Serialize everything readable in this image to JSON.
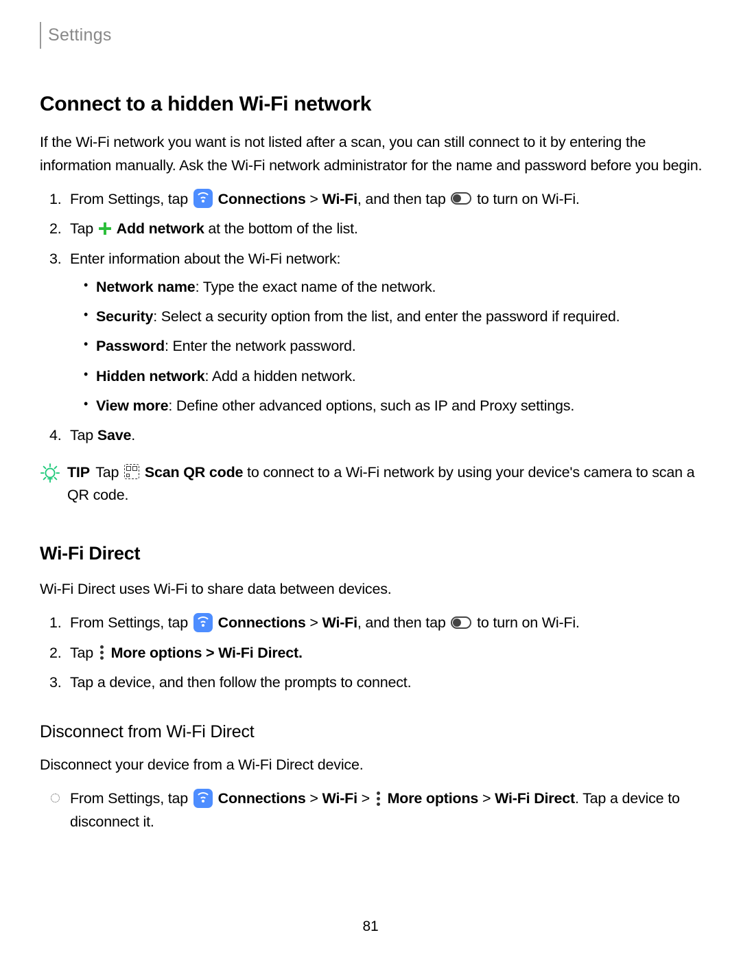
{
  "breadcrumb": "Settings",
  "pageNum": "81",
  "s1": {
    "title": "Connect to a hidden Wi-Fi network",
    "intro": "If the Wi-Fi network you want is not listed after a scan, you can still connect to it by entering the information manually. Ask the Wi-Fi network administrator for the name and password before you begin.",
    "step1_a": "From Settings, tap",
    "step1_b": "Connections",
    "step1_c": ">",
    "step1_d": "Wi-Fi",
    "step1_e": ", and then tap",
    "step1_f": "to turn on Wi-Fi.",
    "step2_a": "Tap",
    "step2_b": "Add network",
    "step2_c": "at the bottom of the list.",
    "step3": "Enter information about the Wi-Fi network:",
    "b1_a": "Network name",
    "b1_b": ": Type the exact name of the network.",
    "b2_a": "Security",
    "b2_b": ": Select a security option from the list, and enter the password if required.",
    "b3_a": "Password",
    "b3_b": ": Enter the network password.",
    "b4_a": "Hidden network",
    "b4_b": ": Add a hidden network.",
    "b5_a": "View more",
    "b5_b": ": Define other advanced options, such as IP and Proxy settings.",
    "step4_a": "Tap ",
    "step4_b": "Save",
    "step4_c": ".",
    "tip_label": "TIP",
    "tip_a": "Tap",
    "tip_b": "Scan QR code",
    "tip_c": "to connect to a Wi-Fi network by using your device's camera to scan a QR code."
  },
  "s2": {
    "title": "Wi-Fi Direct",
    "intro": "Wi-Fi Direct uses Wi-Fi to share data between devices.",
    "step1_a": "From Settings, tap",
    "step1_b": "Connections",
    "step1_c": ">",
    "step1_d": "Wi-Fi",
    "step1_e": ", and then tap",
    "step1_f": "to turn on Wi-Fi.",
    "step2_a": "Tap",
    "step2_b": "More options",
    "step2_c": ">",
    "step2_d": "Wi-Fi Direct",
    "step2_e": ".",
    "step3": "Tap a device, and then follow the prompts to connect."
  },
  "s3": {
    "title": "Disconnect from Wi-Fi Direct",
    "intro": "Disconnect your device from a Wi-Fi Direct device.",
    "step_a": "From Settings, tap",
    "step_b": "Connections",
    "step_c": ">",
    "step_d": "Wi-Fi",
    "step_e": ">",
    "step_f": "More options",
    "step_g": ">",
    "step_h": "Wi-Fi Direct",
    "step_i": ". Tap a device to disconnect it."
  }
}
